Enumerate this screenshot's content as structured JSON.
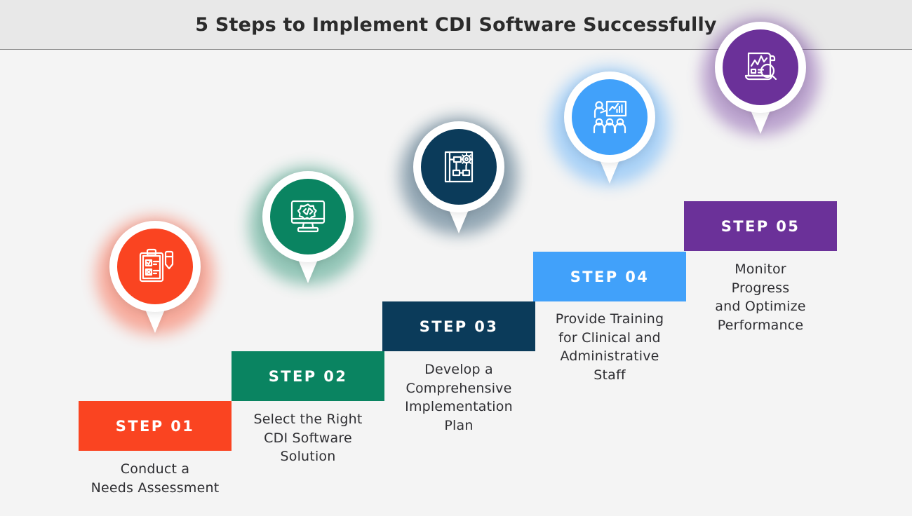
{
  "header": {
    "title": "5 Steps to Implement CDI Software Successfully"
  },
  "colors": {
    "background": "#f4f4f4",
    "header_background": "#e8e8e8",
    "title_text": "#2b2b2b",
    "caption_text": "#2e2e32",
    "step_01": "#fa4421",
    "step_02": "#0a8461",
    "step_03": "#0b3b5a",
    "step_04": "#41a1fa",
    "step_05": "#6b3199"
  },
  "steps": [
    {
      "label": "STEP 01",
      "caption": "Conduct a\nNeeds Assessment",
      "color": "#fa4421",
      "icon": "clipboard-checklist-icon"
    },
    {
      "label": "STEP 02",
      "caption": "Select the Right\nCDI Software\nSolution",
      "color": "#0a8461",
      "icon": "monitor-code-icon"
    },
    {
      "label": "STEP 03",
      "caption": "Develop a\nComprehensive\nImplementation\nPlan",
      "color": "#0b3b5a",
      "icon": "blueprint-gear-icon"
    },
    {
      "label": "STEP 04",
      "caption": "Provide Training\nfor Clinical and\nAdministrative\nStaff",
      "color": "#41a1fa",
      "icon": "training-presentation-icon"
    },
    {
      "label": "STEP 05",
      "caption": "Monitor\nProgress\nand Optimize\nPerformance",
      "color": "#6b3199",
      "icon": "report-magnifier-icon"
    }
  ]
}
